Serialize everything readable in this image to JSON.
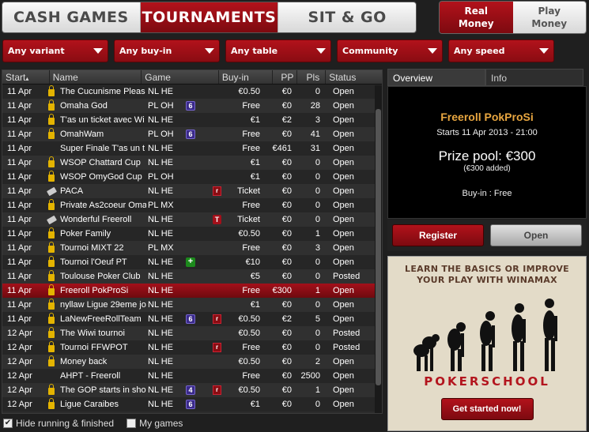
{
  "main_tabs": [
    {
      "label": "CASH GAMES",
      "active": false
    },
    {
      "label": "TOURNAMENTS",
      "active": true
    },
    {
      "label": "SIT & GO",
      "active": false
    }
  ],
  "money_toggle": [
    {
      "line1": "Real",
      "line2": "Money",
      "active": true
    },
    {
      "line1": "Play",
      "line2": "Money",
      "active": false
    }
  ],
  "filters": [
    "Any variant",
    "Any buy-in",
    "Any table",
    "Community",
    "Any speed"
  ],
  "table": {
    "columns": [
      "Start",
      "Name",
      "Game",
      "Buy-in",
      "PP",
      "Pls",
      "Status"
    ],
    "sort_indicator": "▴",
    "rows": [
      {
        "start": "11 Apr",
        "lock": true,
        "name": "The Cucunisme Pleas",
        "game": "NL HE",
        "badge": "",
        "icon": "",
        "buyin": "€0.50",
        "pp": "€0",
        "pls": "0",
        "status": "Open"
      },
      {
        "start": "11 Apr",
        "lock": true,
        "name": "Omaha God",
        "game": "PL OH",
        "badge": "6",
        "icon": "",
        "buyin": "Free",
        "pp": "€0",
        "pls": "28",
        "status": "Open"
      },
      {
        "start": "11 Apr",
        "lock": true,
        "name": "T'as un ticket avec Wi",
        "game": "NL HE",
        "badge": "",
        "icon": "",
        "buyin": "€1",
        "pp": "€2",
        "pls": "3",
        "status": "Open"
      },
      {
        "start": "11 Apr",
        "lock": true,
        "name": "OmahWam",
        "game": "PL OH",
        "badge": "6",
        "icon": "",
        "buyin": "Free",
        "pp": "€0",
        "pls": "41",
        "status": "Open"
      },
      {
        "start": "11 Apr",
        "lock": false,
        "name": "Super Finale T'as un t",
        "game": "NL HE",
        "badge": "",
        "icon": "",
        "buyin": "Free",
        "pp": "€461",
        "pls": "31",
        "status": "Open"
      },
      {
        "start": "11 Apr",
        "lock": true,
        "name": "WSOP Chattard Cup",
        "game": "NL HE",
        "badge": "",
        "icon": "",
        "buyin": "€1",
        "pp": "€0",
        "pls": "0",
        "status": "Open"
      },
      {
        "start": "11 Apr",
        "lock": true,
        "name": "WSOP OmyGod Cup",
        "game": "PL OH",
        "badge": "",
        "icon": "",
        "buyin": "€1",
        "pp": "€0",
        "pls": "0",
        "status": "Open"
      },
      {
        "start": "11 Apr",
        "lock": false,
        "ticket": true,
        "name": "PACA",
        "game": "NL HE",
        "badge": "",
        "icon": "r",
        "buyin": "Ticket",
        "pp": "€0",
        "pls": "0",
        "status": "Open"
      },
      {
        "start": "11 Apr",
        "lock": true,
        "name": "Private As2coeur Oma",
        "game": "PL MX",
        "badge": "",
        "icon": "",
        "buyin": "Free",
        "pp": "€0",
        "pls": "0",
        "status": "Open"
      },
      {
        "start": "11 Apr",
        "lock": false,
        "ticket": true,
        "name": "Wonderful Freeroll",
        "game": "NL HE",
        "badge": "",
        "icon": "T",
        "buyin": "Ticket",
        "pp": "€0",
        "pls": "0",
        "status": "Open"
      },
      {
        "start": "11 Apr",
        "lock": true,
        "name": "Poker Family",
        "game": "NL HE",
        "badge": "",
        "icon": "",
        "buyin": "€0.50",
        "pp": "€0",
        "pls": "1",
        "status": "Open"
      },
      {
        "start": "11 Apr",
        "lock": true,
        "name": "Tournoi MIXT 22",
        "game": "PL MX",
        "badge": "",
        "icon": "",
        "buyin": "Free",
        "pp": "€0",
        "pls": "3",
        "status": "Open"
      },
      {
        "start": "11 Apr",
        "lock": true,
        "name": "Tournoi l'Oeuf PT",
        "game": "NL HE",
        "badge": "+",
        "icon": "",
        "buyin": "€10",
        "pp": "€0",
        "pls": "0",
        "status": "Open"
      },
      {
        "start": "11 Apr",
        "lock": true,
        "name": "Toulouse Poker Club",
        "game": "NL HE",
        "badge": "",
        "icon": "",
        "buyin": "€5",
        "pp": "€0",
        "pls": "0",
        "status": "Posted"
      },
      {
        "start": "11 Apr",
        "lock": true,
        "name": "Freeroll PokProSi",
        "game": "NL HE",
        "badge": "",
        "icon": "",
        "buyin": "Free",
        "pp": "€300",
        "pls": "1",
        "status": "Open",
        "selected": true
      },
      {
        "start": "11 Apr",
        "lock": true,
        "name": "nyllaw Ligue 29eme jo",
        "game": "NL HE",
        "badge": "",
        "icon": "",
        "buyin": "€1",
        "pp": "€0",
        "pls": "0",
        "status": "Open"
      },
      {
        "start": "11 Apr",
        "lock": true,
        "name": "LaNewFreeRollTeam",
        "game": "NL HE",
        "badge": "6",
        "icon": "r",
        "buyin": "€0.50",
        "pp": "€2",
        "pls": "5",
        "status": "Open"
      },
      {
        "start": "12 Apr",
        "lock": true,
        "name": "The Wiwi tournoi",
        "game": "NL HE",
        "badge": "",
        "icon": "",
        "buyin": "€0.50",
        "pp": "€0",
        "pls": "0",
        "status": "Posted"
      },
      {
        "start": "12 Apr",
        "lock": true,
        "name": "Tournoi FFWPOT",
        "game": "NL HE",
        "badge": "",
        "icon": "r",
        "buyin": "Free",
        "pp": "€0",
        "pls": "0",
        "status": "Posted"
      },
      {
        "start": "12 Apr",
        "lock": true,
        "name": "Money back",
        "game": "NL HE",
        "badge": "",
        "icon": "",
        "buyin": "€0.50",
        "pp": "€0",
        "pls": "2",
        "status": "Open"
      },
      {
        "start": "12 Apr",
        "lock": false,
        "name": "AHPT - Freeroll",
        "game": "NL HE",
        "badge": "",
        "icon": "",
        "buyin": "Free",
        "pp": "€0",
        "pls": "2500",
        "status": "Open"
      },
      {
        "start": "12 Apr",
        "lock": true,
        "name": "The GOP starts in sho",
        "game": "NL HE",
        "badge": "4",
        "icon": "r",
        "buyin": "€0.50",
        "pp": "€0",
        "pls": "1",
        "status": "Open"
      },
      {
        "start": "12 Apr",
        "lock": true,
        "name": "Ligue Caraibes",
        "game": "NL HE",
        "badge": "6",
        "icon": "",
        "buyin": "€1",
        "pp": "€0",
        "pls": "0",
        "status": "Open"
      }
    ]
  },
  "bottom_checks": [
    {
      "label": "Hide running & finished",
      "checked": true,
      "mark": "✔"
    },
    {
      "label": "My games",
      "checked": false,
      "mark": ""
    }
  ],
  "panel_tabs": [
    "Overview",
    "Info"
  ],
  "overview": {
    "title": "Freeroll PokProSi",
    "starts": "Starts 11 Apr 2013 - 21:00",
    "prize": "Prize pool: €300",
    "added": "(€300 added)",
    "buyin": "Buy-in : Free"
  },
  "buttons": {
    "register": "Register",
    "open": "Open"
  },
  "ad": {
    "line1": "LEARN THE BASICS OR IMPROVE",
    "line2": "YOUR PLAY WITH WINAMAX",
    "brand": "POKERSCHOOL",
    "cta": "Get started now!"
  }
}
